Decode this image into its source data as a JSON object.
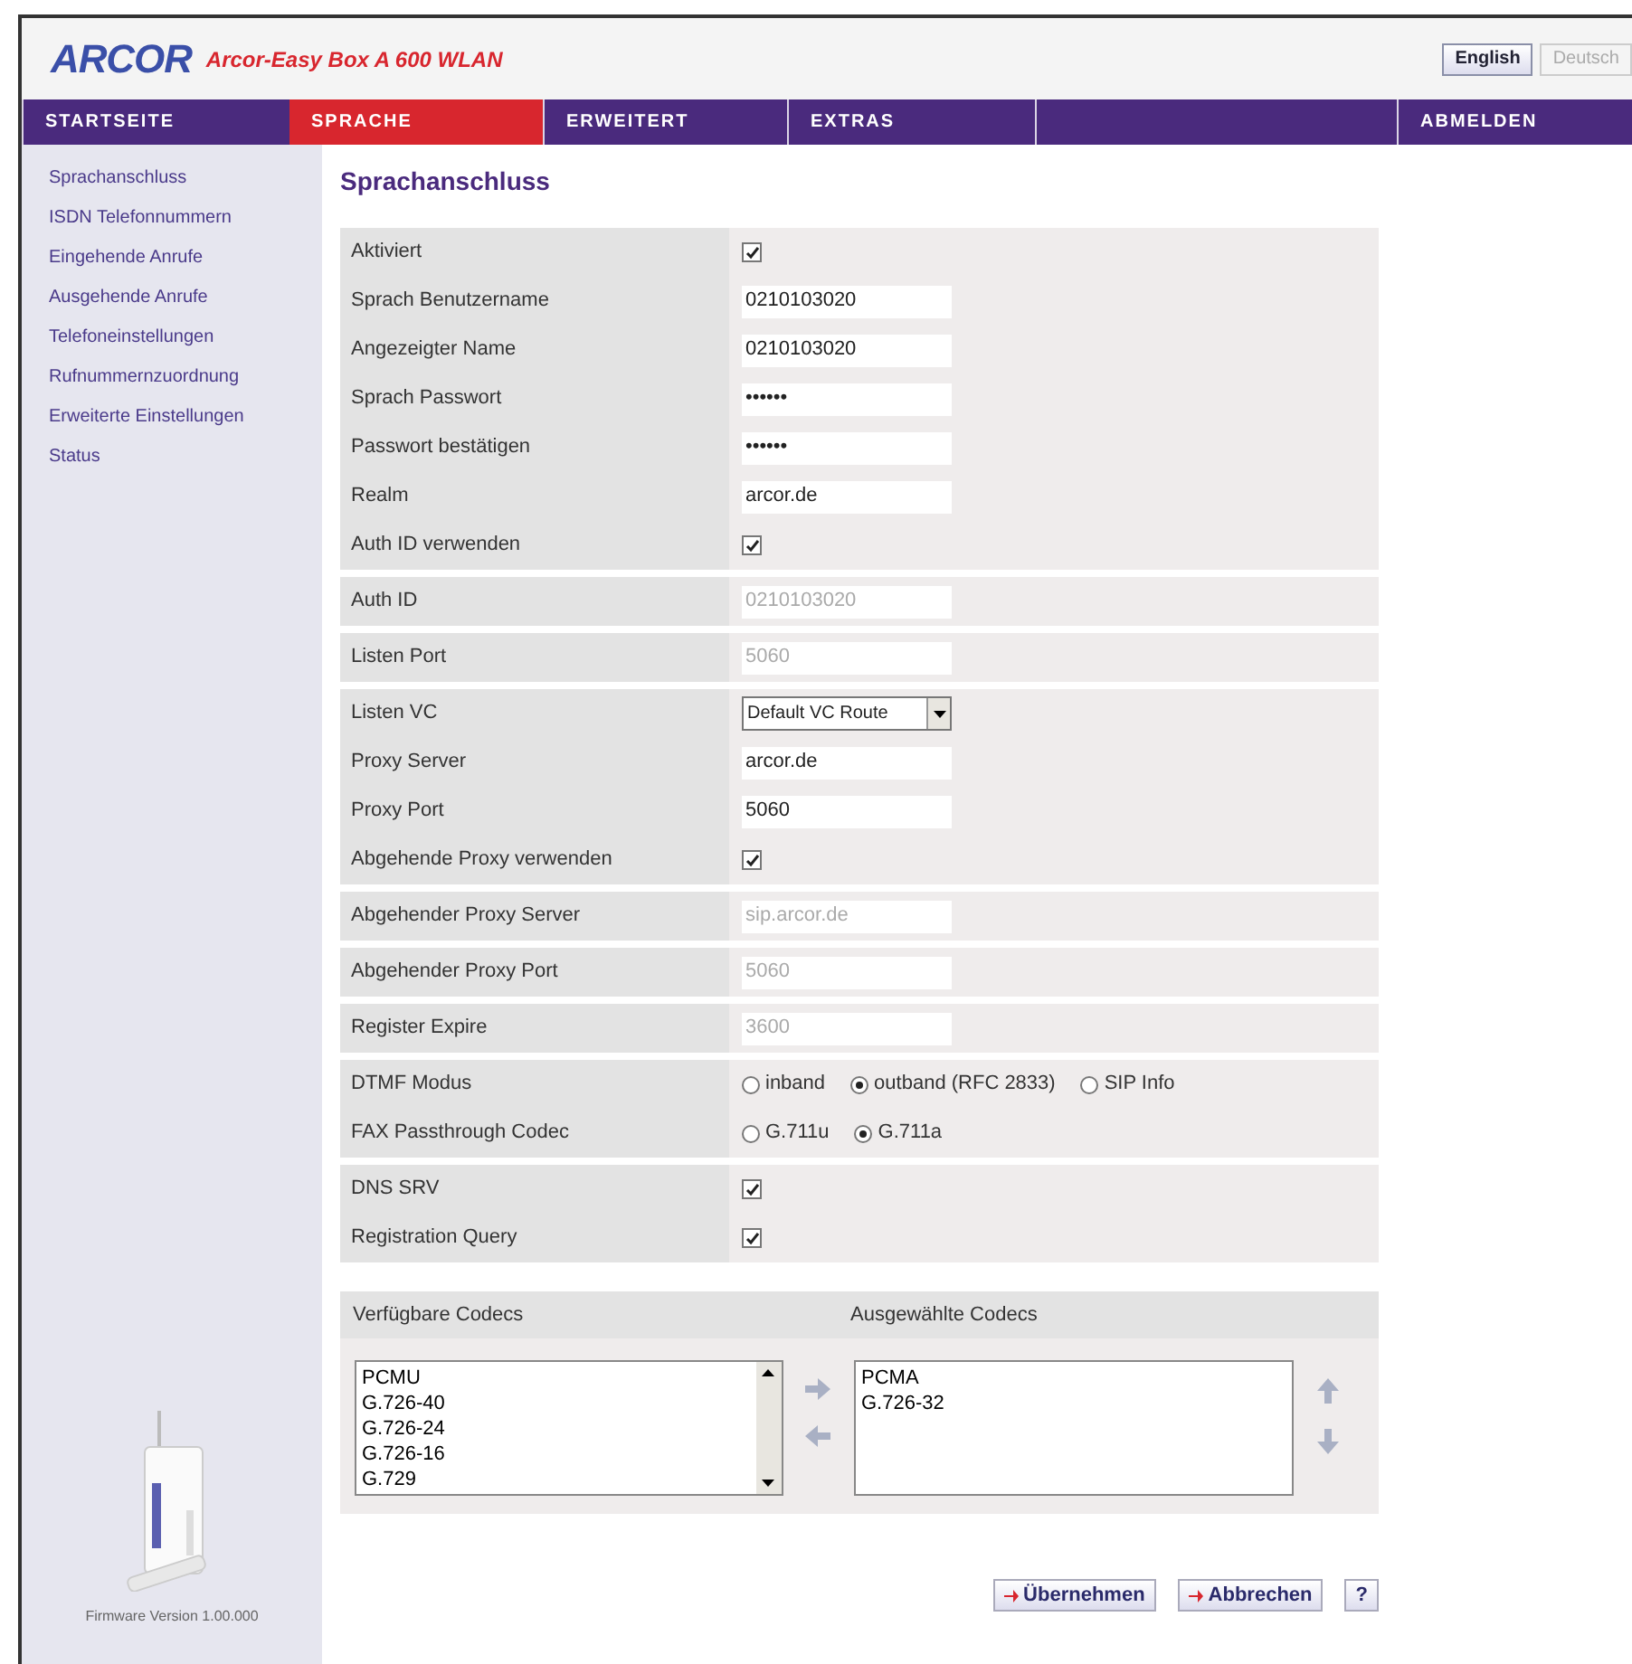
{
  "header": {
    "logo": "ARCOR",
    "product": "Arcor-Easy Box A 600 WLAN",
    "languages": [
      {
        "label": "English",
        "selected": false
      },
      {
        "label": "Deutsch",
        "selected": true
      }
    ]
  },
  "nav": [
    {
      "label": "STARTSEITE",
      "selected": false
    },
    {
      "label": "SPRACHE",
      "selected": true
    },
    {
      "label": "ERWEITERT",
      "selected": false
    },
    {
      "label": "EXTRAS",
      "selected": false
    },
    {
      "label": "ABMELDEN",
      "selected": false
    }
  ],
  "sidebar": {
    "items": [
      "Sprachanschluss",
      "ISDN Telefonnummern",
      "Eingehende Anrufe",
      "Ausgehende Anrufe",
      "Telefoneinstellungen",
      "Rufnummernzuordnung",
      "Erweiterte Einstellungen",
      "Status"
    ],
    "firmware": "Firmware Version 1.00.000"
  },
  "page_title": "Sprachanschluss",
  "form_groups": [
    {
      "rows": [
        {
          "kind": "checkbox",
          "label": "Aktiviert",
          "checked": true
        },
        {
          "kind": "text",
          "label": "Sprach Benutzername",
          "value": "0210103020",
          "disabled": false
        },
        {
          "kind": "text",
          "label": "Angezeigter Name",
          "value": "0210103020",
          "disabled": false
        },
        {
          "kind": "text",
          "label": "Sprach Passwort",
          "value": "••••••",
          "disabled": false
        },
        {
          "kind": "text",
          "label": "Passwort bestätigen",
          "value": "••••••",
          "disabled": false
        },
        {
          "kind": "text",
          "label": "Realm",
          "value": "arcor.de",
          "disabled": false
        },
        {
          "kind": "checkbox",
          "label": "Auth ID verwenden",
          "checked": true
        }
      ]
    },
    {
      "rows": [
        {
          "kind": "text",
          "label": "Auth ID",
          "value": "0210103020",
          "disabled": true
        }
      ]
    },
    {
      "rows": [
        {
          "kind": "text",
          "label": "Listen Port",
          "value": "5060",
          "disabled": true
        }
      ]
    },
    {
      "rows": [
        {
          "kind": "select",
          "label": "Listen VC",
          "value": "Default VC Route"
        },
        {
          "kind": "text",
          "label": "Proxy Server",
          "value": "arcor.de",
          "disabled": false
        },
        {
          "kind": "text",
          "label": "Proxy Port",
          "value": "5060",
          "disabled": false
        },
        {
          "kind": "checkbox",
          "label": "Abgehende Proxy verwenden",
          "checked": true
        }
      ]
    },
    {
      "rows": [
        {
          "kind": "text",
          "label": "Abgehender Proxy Server",
          "value": "sip.arcor.de",
          "disabled": true
        }
      ]
    },
    {
      "rows": [
        {
          "kind": "text",
          "label": "Abgehender Proxy Port",
          "value": "5060",
          "disabled": true
        }
      ]
    },
    {
      "rows": [
        {
          "kind": "text",
          "label": "Register Expire",
          "value": "3600",
          "disabled": true
        }
      ]
    },
    {
      "rows": [
        {
          "kind": "radio",
          "label": "DTMF Modus",
          "options": [
            {
              "label": "inband",
              "selected": false
            },
            {
              "label": "outband (RFC 2833)",
              "selected": true
            },
            {
              "label": "SIP Info",
              "selected": false
            }
          ]
        },
        {
          "kind": "radio",
          "label": "FAX Passthrough Codec",
          "options": [
            {
              "label": "G.711u",
              "selected": false
            },
            {
              "label": "G.711a",
              "selected": true
            }
          ]
        }
      ]
    },
    {
      "rows": [
        {
          "kind": "checkbox",
          "label": "DNS SRV",
          "checked": true
        },
        {
          "kind": "checkbox",
          "label": "Registration Query",
          "checked": true
        }
      ]
    }
  ],
  "codecs": {
    "available_title": "Verfügbare Codecs",
    "selected_title": "Ausgewählte Codecs",
    "available": [
      "PCMU",
      "G.726-40",
      "G.726-24",
      "G.726-16",
      "G.729"
    ],
    "chosen": [
      "PCMA",
      "G.726-32"
    ]
  },
  "buttons": [
    {
      "kind": "apply",
      "label": "Übernehmen"
    },
    {
      "kind": "cancel",
      "label": "Abbrechen"
    },
    {
      "kind": "help",
      "label": "?"
    }
  ]
}
